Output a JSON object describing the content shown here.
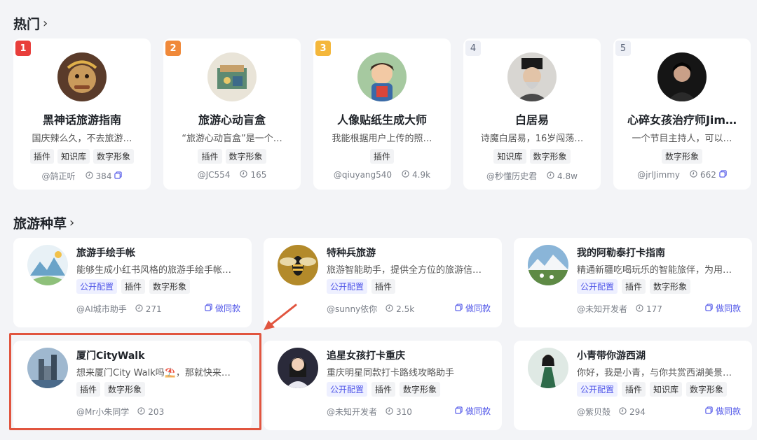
{
  "hot": {
    "title": "热门",
    "cards": [
      {
        "rank": "1",
        "rank_color": "#e83e3b",
        "name": "黑神话旅游指南",
        "desc": "国庆辣么久，不去旅游…",
        "tags": [
          "插件",
          "知识库",
          "数字形象"
        ],
        "author": "@鹄正听",
        "count": "384"
      },
      {
        "rank": "2",
        "rank_color": "#f0893a",
        "name": "旅游心动盲盒",
        "desc": "“旅游心动盲盒”是一个…",
        "tags": [
          "插件",
          "数字形象"
        ],
        "author": "@JC554",
        "count": "165"
      },
      {
        "rank": "3",
        "rank_color": "#f4b73b",
        "name": "人像贴纸生成大师",
        "desc": "我能根据用户上传的照…",
        "tags": [
          "插件"
        ],
        "author": "@qiuyang540",
        "count": "4.9k"
      },
      {
        "rank": "4",
        "name": "白居易",
        "desc": "诗魔白居易，16岁闯荡…",
        "tags": [
          "知识库",
          "数字形象"
        ],
        "author": "@秒懂历史君",
        "count": "4.8w"
      },
      {
        "rank": "5",
        "name": "心碎女孩治疗师Jim…",
        "desc": "一个节目主持人，可以…",
        "tags": [
          "数字形象"
        ],
        "author": "@jrlJimmy",
        "count": "662"
      }
    ]
  },
  "travel": {
    "title": "旅游种草",
    "same_label": "做同款",
    "cards": [
      {
        "name": "旅游手绘手帐",
        "desc": "能够生成小红书风格的旅游手绘手帐…",
        "tags": [
          "公开配置",
          "插件",
          "数字形象"
        ],
        "author": "@AI城市助手",
        "count": "271",
        "has_same": true
      },
      {
        "name": "特种兵旅游",
        "desc": "旅游智能助手，提供全方位的旅游信…",
        "tags": [
          "公开配置",
          "插件"
        ],
        "author": "@sunny依你",
        "count": "2.5k",
        "has_same": true
      },
      {
        "name": "我的阿勒泰打卡指南",
        "desc": "精通新疆吃喝玩乐的智能旅伴，为用…",
        "tags": [
          "公开配置",
          "插件",
          "数字形象"
        ],
        "author": "@未知开发者",
        "count": "177",
        "has_same": true
      },
      {
        "name": "厦门CityWalk",
        "desc": "想来厦门City Walk吗⛱️，那就快来…",
        "tags": [
          "插件",
          "数字形象"
        ],
        "author": "@Mr小朱同学",
        "count": "203",
        "has_same": false
      },
      {
        "name": "追星女孩打卡重庆",
        "desc": "重庆明星同款打卡路线攻略助手",
        "tags": [
          "公开配置",
          "插件",
          "数字形象"
        ],
        "author": "@未知开发者",
        "count": "310",
        "has_same": true
      },
      {
        "name": "小青带你游西湖",
        "desc": "你好，我是小青，与你共赏西湖美景…",
        "tags": [
          "公开配置",
          "插件",
          "知识库",
          "数字形象"
        ],
        "author": "@紫贝殻",
        "count": "294",
        "has_same": true
      }
    ]
  },
  "colors": {
    "accent": "#4d53e8",
    "highlight": "#e1553f"
  }
}
